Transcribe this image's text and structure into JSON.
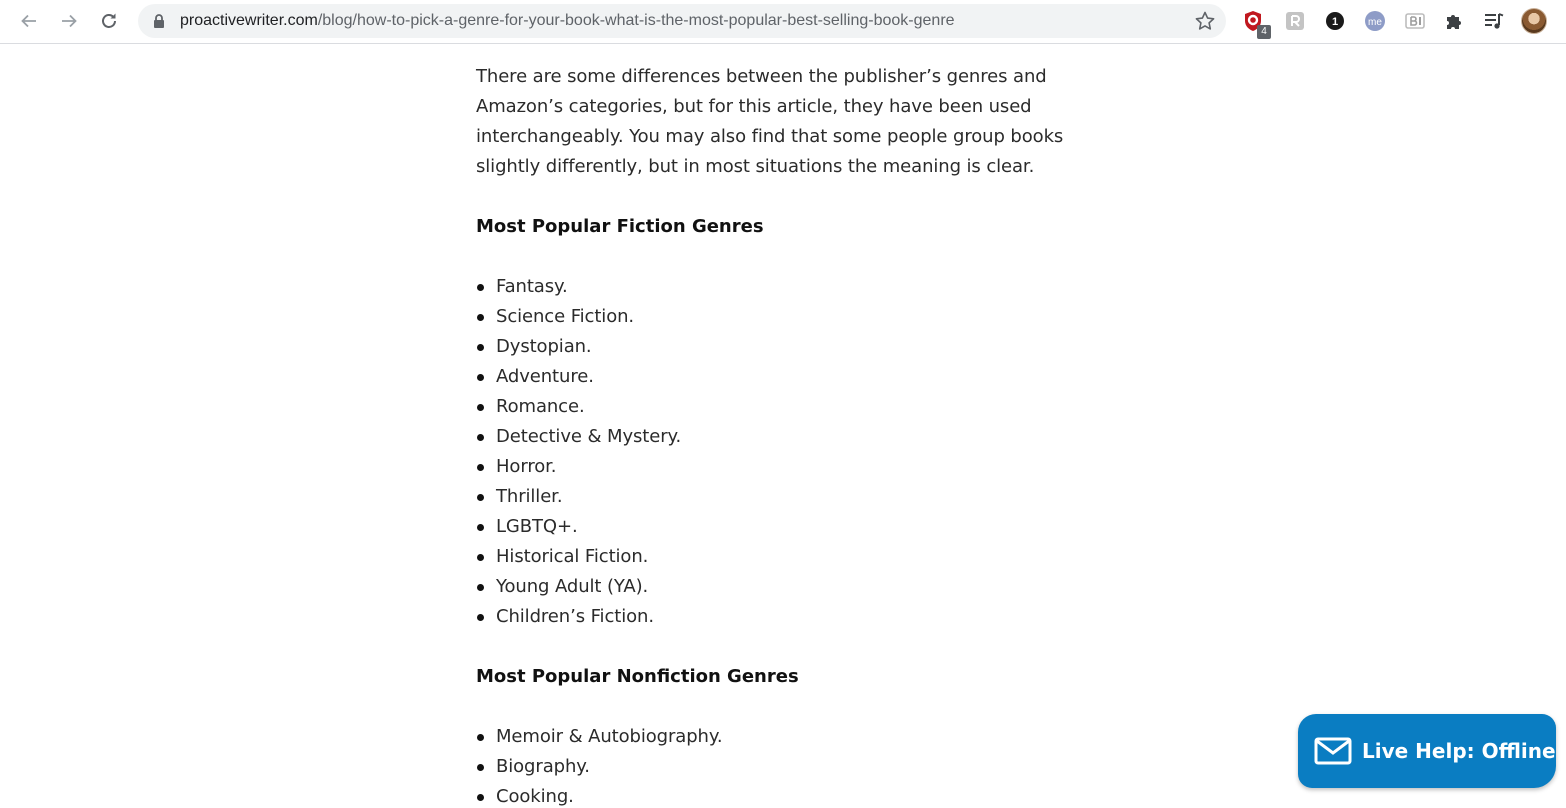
{
  "browser": {
    "url_host": "proactivewriter.com",
    "url_path": "/blog/how-to-pick-a-genre-for-your-book-what-is-the-most-popular-best-selling-book-genre",
    "extensions": [
      {
        "name": "ublock-icon",
        "badge": "4"
      },
      {
        "name": "r-extension-icon"
      },
      {
        "name": "onepassword-icon",
        "text": "1"
      },
      {
        "name": "me-extension-icon",
        "text": "me"
      },
      {
        "name": "b-extension-icon"
      },
      {
        "name": "extensions-puzzle-icon"
      },
      {
        "name": "media-control-icon"
      },
      {
        "name": "profile-avatar"
      }
    ]
  },
  "article": {
    "intro": "There are some differences between the publisher’s genres and Amazon’s categories, but for this article, they have been used interchangeably. You may also find that some people group books slightly differently, but in most situations the meaning is clear.",
    "fiction_heading": "Most Popular Fiction Genres",
    "fiction_items": [
      "Fantasy.",
      "Science Fiction.",
      "Dystopian.",
      "Adventure.",
      "Romance.",
      "Detective & Mystery.",
      "Horror.",
      "Thriller.",
      "LGBTQ+.",
      "Historical Fiction.",
      "Young Adult (YA).",
      "Children’s Fiction."
    ],
    "nonfiction_heading": "Most Popular Nonfiction Genres",
    "nonfiction_items": [
      "Memoir & Autobiography.",
      "Biography.",
      "Cooking."
    ]
  },
  "live_help": {
    "label": "Live Help: Offline",
    "color": "#0a7dc2"
  }
}
